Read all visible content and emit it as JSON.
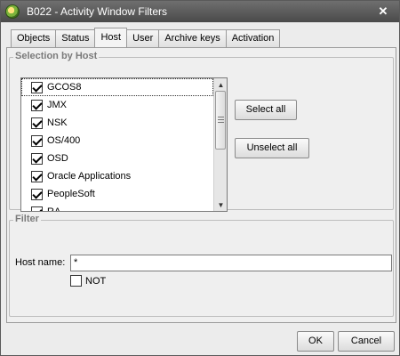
{
  "window": {
    "title": "B022 - Activity Window Filters"
  },
  "tabs": [
    {
      "label": "Objects"
    },
    {
      "label": "Status"
    },
    {
      "label": "Host",
      "active": true
    },
    {
      "label": "User"
    },
    {
      "label": "Archive keys"
    },
    {
      "label": "Activation"
    }
  ],
  "host_group": {
    "title": "Selection by Host",
    "items": [
      {
        "label": "GCOS8",
        "checked": true
      },
      {
        "label": "JMX",
        "checked": true
      },
      {
        "label": "NSK",
        "checked": true
      },
      {
        "label": "OS/400",
        "checked": true
      },
      {
        "label": "OSD",
        "checked": true
      },
      {
        "label": "Oracle Applications",
        "checked": true
      },
      {
        "label": "PeopleSoft",
        "checked": true
      },
      {
        "label": "RA",
        "checked": true
      }
    ],
    "select_all_label": "Select all",
    "unselect_all_label": "Unselect all"
  },
  "filter_group": {
    "title": "Filter",
    "host_name_label": "Host name:",
    "host_name_value": "*",
    "not_label": "NOT",
    "not_checked": false
  },
  "footer": {
    "ok_label": "OK",
    "cancel_label": "Cancel"
  }
}
